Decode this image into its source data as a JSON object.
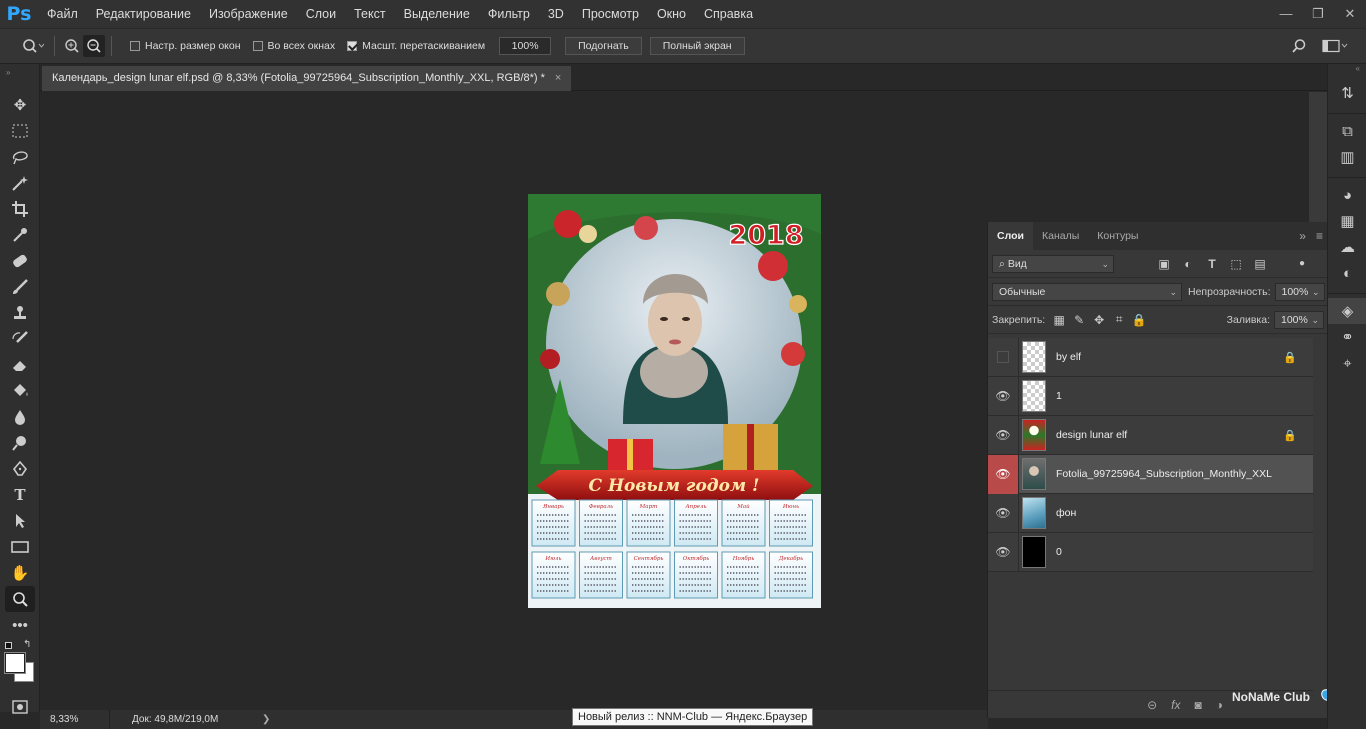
{
  "app": {
    "logo": "Ps"
  },
  "menu": [
    "Файл",
    "Редактирование",
    "Изображение",
    "Слои",
    "Текст",
    "Выделение",
    "Фильтр",
    "3D",
    "Просмотр",
    "Окно",
    "Справка"
  ],
  "window_controls": {
    "minimize": "—",
    "restore": "❐",
    "close": "✕"
  },
  "options": {
    "resize_windows": "Настр. размер окон",
    "all_windows": "Во всех окнах",
    "scrubby_zoom": "Масшт. перетаскиванием",
    "zoom_value": "100%",
    "fit_button": "Подогнать",
    "fullscreen_button": "Полный экран"
  },
  "document": {
    "tab_title": "Календарь_design lunar elf.psd @ 8,33% (Fotolia_99725964_Subscription_Monthly_XXL, RGB/8*) *",
    "close": "×",
    "year": "2018",
    "banner": "С Новым годом !",
    "months": [
      "Январь",
      "Февраль",
      "Март",
      "Апрель",
      "Май",
      "Июнь",
      "Июль",
      "Август",
      "Сентябрь",
      "Октябрь",
      "Ноябрь",
      "Декабрь"
    ]
  },
  "status": {
    "zoom": "8,33%",
    "doc_info": "Док: 49,8M/219,0M",
    "arrow": "❯"
  },
  "tooltip": "Новый релиз :: NNM-Club — Яндекс.Браузер",
  "layers_panel": {
    "tabs": [
      "Слои",
      "Каналы",
      "Контуры"
    ],
    "filter_kind": "Вид",
    "blend_mode": "Обычные",
    "opacity_label": "Непрозрачность:",
    "opacity_value": "100%",
    "lock_label": "Закрепить:",
    "fill_label": "Заливка:",
    "fill_value": "100%",
    "layers": [
      {
        "name": "by elf",
        "visible": false,
        "locked": true,
        "thumb": "trans"
      },
      {
        "name": "1",
        "visible": true,
        "locked": false,
        "thumb": "trans"
      },
      {
        "name": "design lunar elf",
        "visible": true,
        "locked": true,
        "thumb": "design"
      },
      {
        "name": "Fotolia_99725964_Subscription_Monthly_XXL",
        "visible": true,
        "locked": false,
        "thumb": "photo",
        "selected": true
      },
      {
        "name": "фон",
        "visible": true,
        "locked": false,
        "thumb": "fon"
      },
      {
        "name": "0",
        "visible": true,
        "locked": false,
        "thumb": "black"
      }
    ]
  },
  "watermark": "NoNaMe Club"
}
